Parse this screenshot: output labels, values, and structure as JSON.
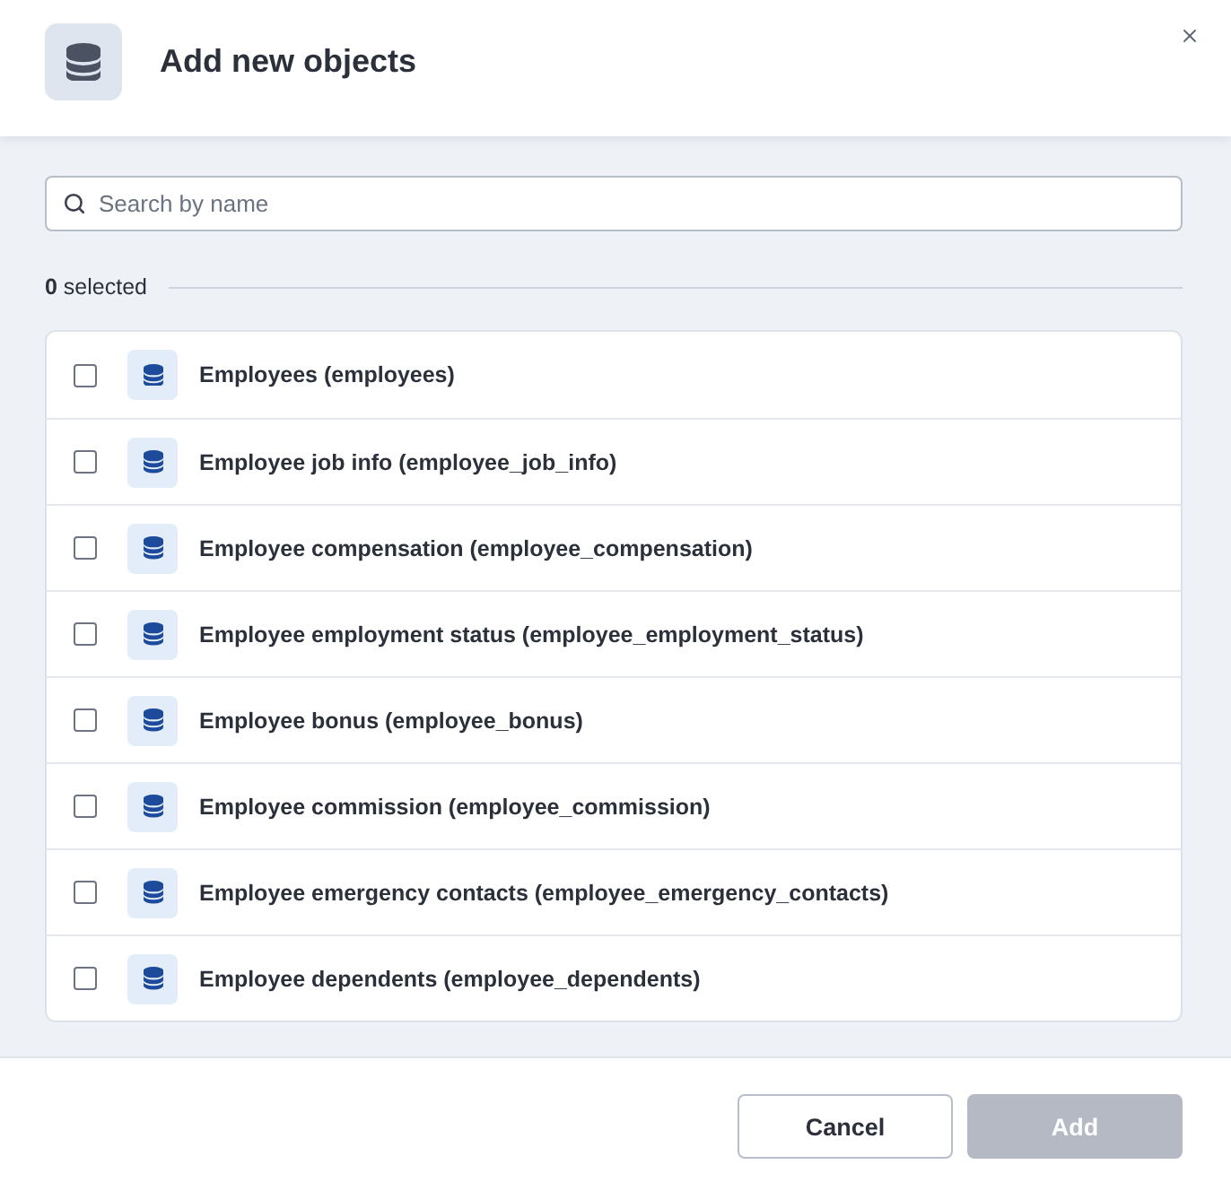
{
  "dialog": {
    "title": "Add new objects"
  },
  "search": {
    "placeholder": "Search by name"
  },
  "selection": {
    "summary": "**0** selected"
  },
  "objects": [
    {
      "label": "Employees (employees)",
      "checked": false
    },
    {
      "label": "Employee job info (employee_job_info)",
      "checked": false
    },
    {
      "label": "Employee compensation (employee_compensation)",
      "checked": false
    },
    {
      "label": "Employee employment status (employee_employment_status)",
      "checked": false
    },
    {
      "label": "Employee bonus (employee_bonus)",
      "checked": false
    },
    {
      "label": "Employee commission (employee_commission)",
      "checked": false
    },
    {
      "label": "Employee emergency contacts (employee_emergency_contacts)",
      "checked": false
    },
    {
      "label": "Employee dependents (employee_dependents)",
      "checked": false
    }
  ],
  "buttons": [
    {
      "label": "Cancel",
      "kind": "secondary",
      "disabled": false
    },
    {
      "label": "Add",
      "kind": "primary",
      "disabled": true
    }
  ]
}
